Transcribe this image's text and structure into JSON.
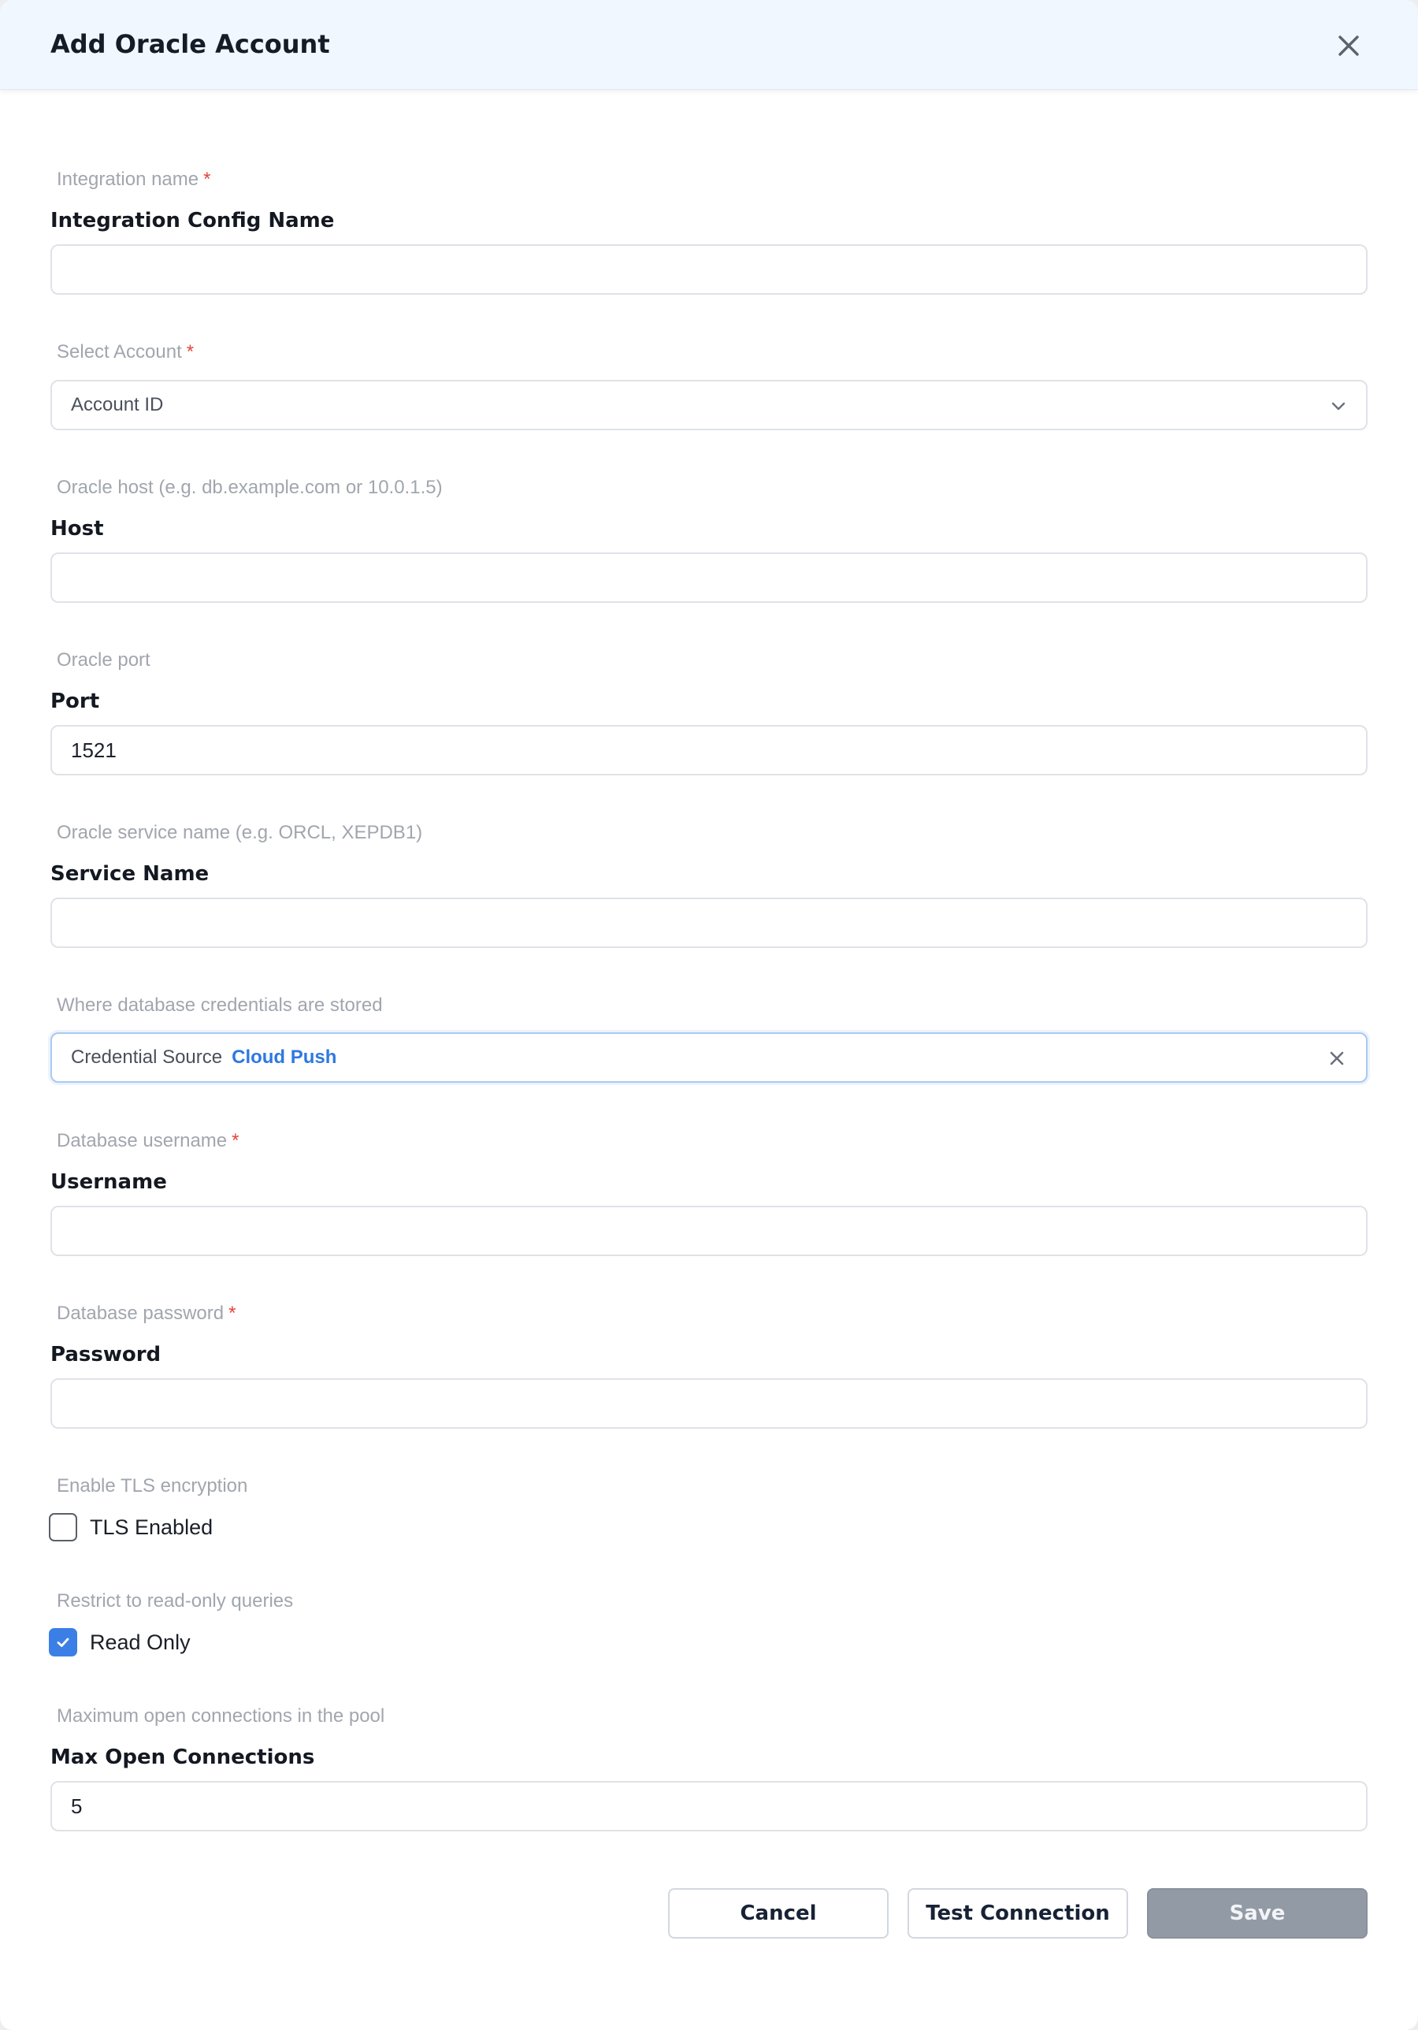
{
  "modal": {
    "title": "Add Oracle Account"
  },
  "fields": {
    "integration_name": {
      "hint": "Integration name",
      "label": "Integration Config Name",
      "value": "",
      "required": true
    },
    "account": {
      "hint": "Select Account",
      "value": "Account ID",
      "required": true
    },
    "host": {
      "hint": "Oracle host (e.g. db.example.com or 10.0.1.5)",
      "label": "Host",
      "value": ""
    },
    "port": {
      "hint": "Oracle port",
      "label": "Port",
      "value": "1521"
    },
    "service_name": {
      "hint": "Oracle service name (e.g. ORCL, XEPDB1)",
      "label": "Service Name",
      "value": ""
    },
    "credential_source": {
      "hint": "Where database credentials are stored",
      "key": "Credential Source",
      "value": "Cloud Push"
    },
    "username": {
      "hint": "Database username",
      "label": "Username",
      "value": "",
      "required": true
    },
    "password": {
      "hint": "Database password",
      "label": "Password",
      "value": "",
      "required": true
    },
    "tls": {
      "hint": "Enable TLS encryption",
      "label": "TLS Enabled",
      "checked": false
    },
    "read_only": {
      "hint": "Restrict to read-only queries",
      "label": "Read Only",
      "checked": true
    },
    "max_open_connections": {
      "hint": "Maximum open connections in the pool",
      "label": "Max Open Connections",
      "value": "5"
    }
  },
  "required_marker": "*",
  "buttons": {
    "cancel": "Cancel",
    "test": "Test Connection",
    "save": "Save"
  },
  "colors": {
    "header_bg": "#f1f7fe",
    "accent": "#3b7fe6",
    "required": "#e0453a",
    "save_disabled": "#929aa6"
  }
}
